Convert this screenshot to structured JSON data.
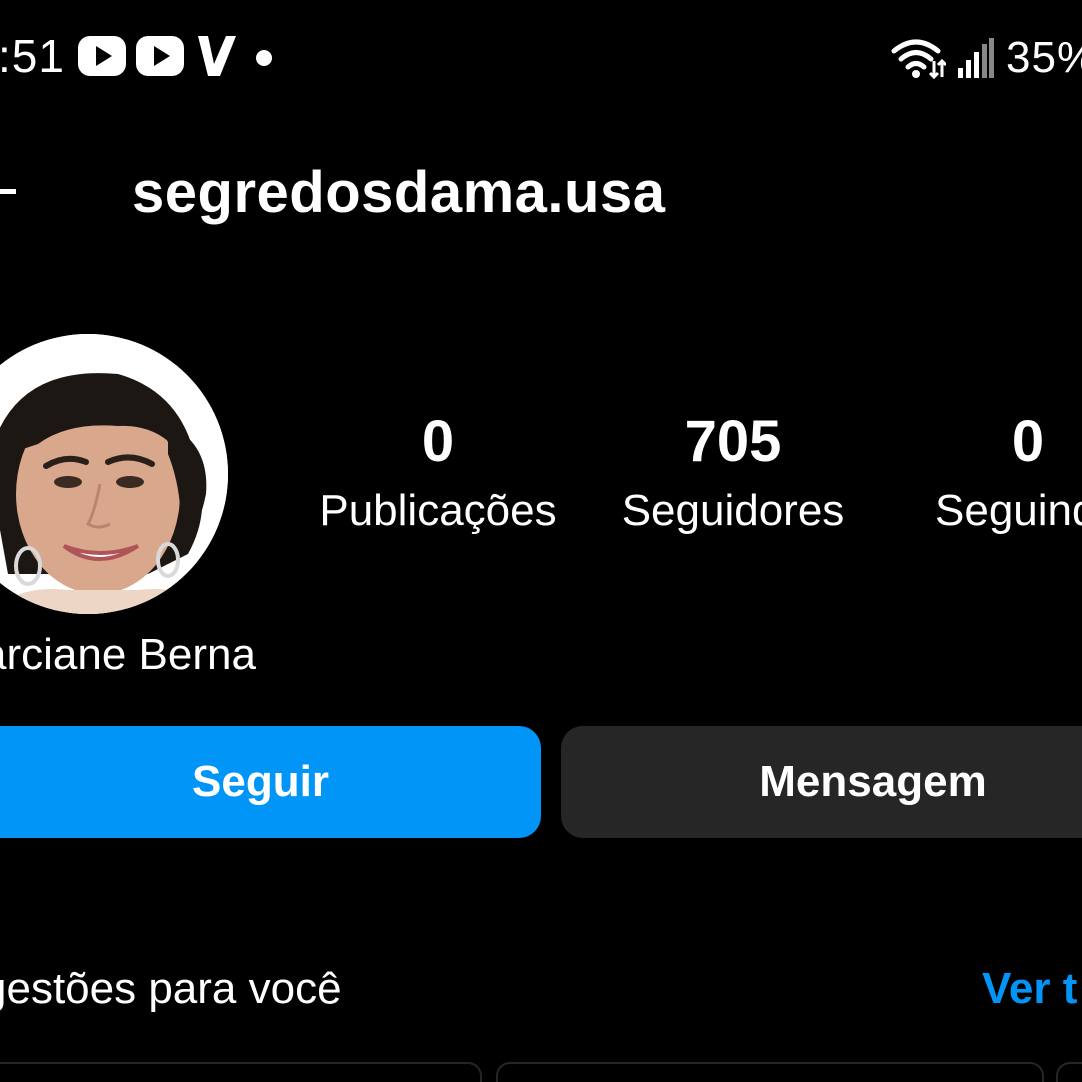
{
  "status_bar": {
    "time": ":51",
    "battery": "35%",
    "icons_left": [
      "youtube-icon",
      "youtube-icon",
      "vivo-icon",
      "dot-icon"
    ],
    "icons_right": [
      "wifi-icon",
      "signal-icon"
    ]
  },
  "header": {
    "back_icon": "back-arrow-icon",
    "username": "segredosdama.usa"
  },
  "profile": {
    "avatar": "profile-photo",
    "full_name": "arciane Berna",
    "stats": {
      "posts": {
        "value": "0",
        "label": "Publicações"
      },
      "followers": {
        "value": "705",
        "label": "Seguidores"
      },
      "following": {
        "value": "0",
        "label": "Seguindo"
      }
    }
  },
  "actions": {
    "follow_label": "Seguir",
    "message_label": "Mensagem"
  },
  "suggestions": {
    "title": "gestões para você",
    "see_all": "Ver t"
  },
  "colors": {
    "background": "#000000",
    "primary_button": "#0095f6",
    "secondary_button": "#262626",
    "link": "#0095f6",
    "text": "#ffffff"
  }
}
